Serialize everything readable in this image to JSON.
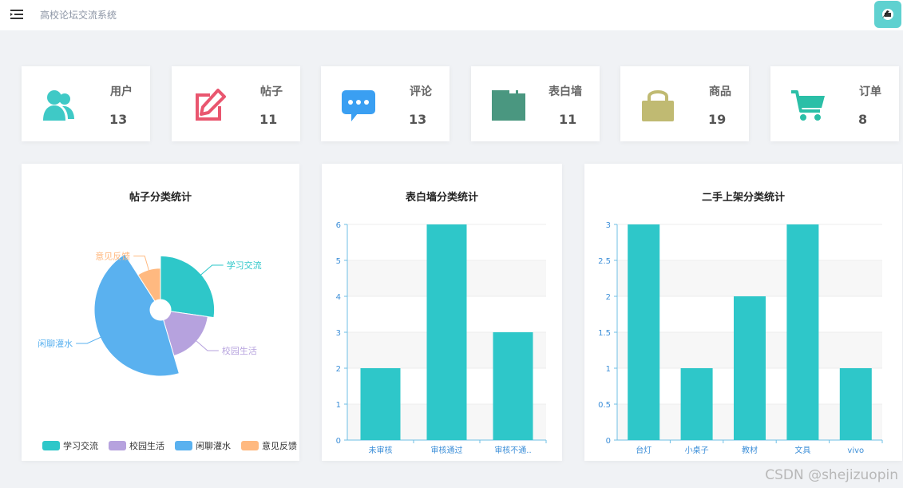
{
  "header": {
    "title": "高校论坛交流系统"
  },
  "stats": [
    {
      "label": "用户",
      "value": "13",
      "icon": "users-icon",
      "color": "#3fc9c6"
    },
    {
      "label": "帖子",
      "value": "11",
      "icon": "edit-icon",
      "color": "#e9566f"
    },
    {
      "label": "评论",
      "value": "13",
      "icon": "comment-icon",
      "color": "#3a9ff2"
    },
    {
      "label": "表白墙",
      "value": "11",
      "icon": "wall-icon",
      "color": "#4a9780"
    },
    {
      "label": "商品",
      "value": "19",
      "icon": "bag-icon",
      "color": "#c0ba72"
    },
    {
      "label": "订单",
      "value": "8",
      "icon": "cart-icon",
      "color": "#2bbfa7"
    }
  ],
  "colors": {
    "teal": "#2ec7c9",
    "purple": "#b6a2de",
    "blue": "#5ab1ef",
    "orange": "#ffb980",
    "axis": "#6fbfe6"
  },
  "chart_data": [
    {
      "type": "pie",
      "title": "帖子分类统计",
      "categories": [
        "学习交流",
        "校园生活",
        "闲聊灌水",
        "意见反馈"
      ],
      "values": [
        3,
        2,
        5,
        1
      ],
      "legend": "bottom"
    },
    {
      "type": "bar",
      "title": "表白墙分类统计",
      "categories": [
        "未审核",
        "审核通过",
        "审核不通.."
      ],
      "values": [
        2,
        6,
        3
      ],
      "ylim": [
        0,
        6
      ],
      "yticks": [
        "0",
        "1",
        "2",
        "3",
        "4",
        "5",
        "6"
      ]
    },
    {
      "type": "bar",
      "title": "二手上架分类统计",
      "categories": [
        "台灯",
        "小桌子",
        "教材",
        "文具",
        "vivo"
      ],
      "values": [
        3,
        1,
        2,
        3,
        1
      ],
      "ylim": [
        0,
        3
      ],
      "yticks": [
        "0",
        "0.5",
        "1",
        "1.5",
        "2",
        "2.5",
        "3"
      ]
    }
  ],
  "watermark": "CSDN @shejizuopin"
}
